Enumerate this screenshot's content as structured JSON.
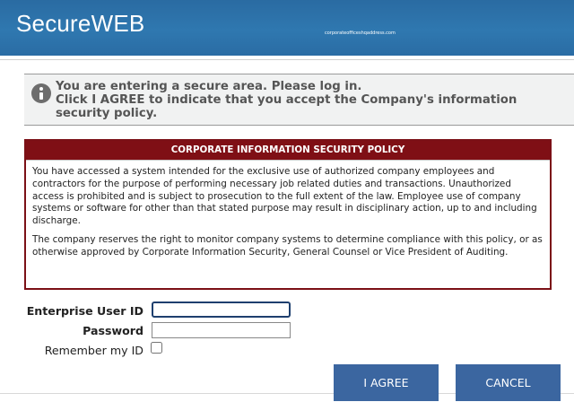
{
  "header": {
    "logo_text": "SecureWEB",
    "watermark": "corporateofficeshqaddress.com"
  },
  "notice": {
    "icon": "info-icon",
    "line1": "You are entering a secure area.  Please log in.",
    "line2": "Click I AGREE to indicate that you accept the Company's information security policy."
  },
  "policy": {
    "title": "CORPORATE INFORMATION SECURITY POLICY",
    "paragraph1": "You have accessed a system intended for the exclusive use of authorized company employees and contractors for the purpose of performing necessary job related duties and transactions. Unauthorized access is prohibited and is subject to prosecution to the full extent of the law. Employee use of company systems or software for other than that stated purpose may result in disciplinary action, up to and including discharge.",
    "paragraph2": "The company reserves the right to monitor company systems to determine compliance with this policy, or as otherwise approved by Corporate Information Security, General Counsel or Vice President of Auditing."
  },
  "form": {
    "user_id_label": "Enterprise User ID",
    "user_id_value": "",
    "password_label": "Password",
    "password_value": "",
    "remember_label": "Remember my ID",
    "remember_checked": false
  },
  "buttons": {
    "agree": "I AGREE",
    "cancel": "CANCEL"
  },
  "colors": {
    "header_bg": "#2f78b0",
    "policy_red": "#7f0f15",
    "button_blue": "#3b66a0"
  }
}
